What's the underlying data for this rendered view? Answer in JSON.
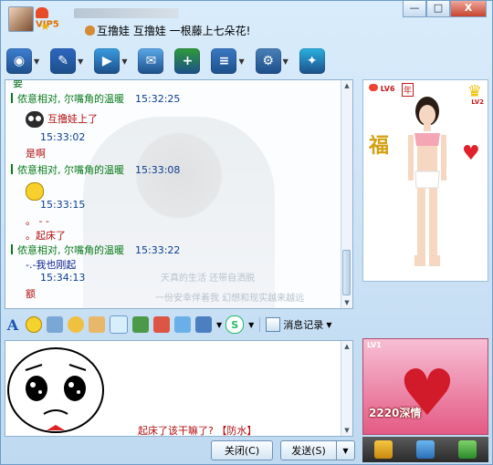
{
  "titlebar": {
    "vip_text": "VIP5",
    "signature": "互撸娃  互撸娃  一根藤上七朵花!",
    "buttons": {
      "minimize": "—",
      "maximize": "□",
      "close": "X"
    }
  },
  "toolbar": {
    "items": [
      {
        "name": "video",
        "color": "#3e7fd0",
        "glyph": "◉"
      },
      {
        "name": "voice",
        "color": "#2e66c0",
        "glyph": "✎"
      },
      {
        "name": "transfer-file",
        "color": "#3a9ce0",
        "glyph": "▶"
      },
      {
        "name": "send-sms",
        "color": "#5aa8e8",
        "glyph": "✉"
      },
      {
        "name": "create-group",
        "color": "#2f9a3a",
        "glyph": "+"
      },
      {
        "name": "apps",
        "color": "#3b79c2",
        "glyph": "≡"
      },
      {
        "name": "settings",
        "color": "#4a7fb8",
        "glyph": "⚙"
      },
      {
        "name": "qq-space",
        "color": "#2bb0e0",
        "glyph": "✦"
      }
    ]
  },
  "chat": {
    "top_cut": "要",
    "messages": [
      {
        "kind": "header",
        "sender": "侬意相对, 尔嘴角的温暖",
        "time": "15:32:25"
      },
      {
        "kind": "text",
        "icon": "owl",
        "text": "互撸娃上了",
        "color": "red"
      },
      {
        "kind": "time",
        "text": "15:33:02"
      },
      {
        "kind": "text",
        "text": "是啊",
        "color": "red"
      },
      {
        "kind": "header",
        "sender": "侬意相对, 尔嘴角的温暖",
        "time": "15:33:08"
      },
      {
        "kind": "emoji"
      },
      {
        "kind": "time",
        "text": "15:33:15"
      },
      {
        "kind": "text",
        "text": "。 -  -",
        "color": "red"
      },
      {
        "kind": "text",
        "text": "。起床了",
        "color": "red"
      },
      {
        "kind": "header",
        "sender": "侬意相对, 尔嘴角的温暖",
        "time": "15:33:22"
      },
      {
        "kind": "text",
        "text": "-.-我也刚起",
        "color": "navy"
      },
      {
        "kind": "time",
        "text": "15:34:13"
      },
      {
        "kind": "text",
        "text": "额",
        "color": "red"
      }
    ],
    "faded_lines": [
      "天真的生活  还带自洒脱",
      "一份安幸伴着我  幻想和现实越来越远"
    ]
  },
  "show_panel": {
    "level": "LV6",
    "year_badge": "年",
    "level2": "LV2",
    "fu_char": "福"
  },
  "format_bar": {
    "font_glyph": "A",
    "history_label": "消息记录"
  },
  "input": {
    "text": "起床了该干嘛了?         【防水】"
  },
  "buttons": {
    "close_label": "关闭(C)",
    "send_label": "发送(S)"
  },
  "gift_panel": {
    "level": "LV1",
    "label": "2220深情"
  },
  "colors": {
    "header_green": "#0a7a1a",
    "time_blue": "#0a3d8f",
    "text_red": "#b20f0f",
    "text_navy": "#0a1f8a"
  }
}
